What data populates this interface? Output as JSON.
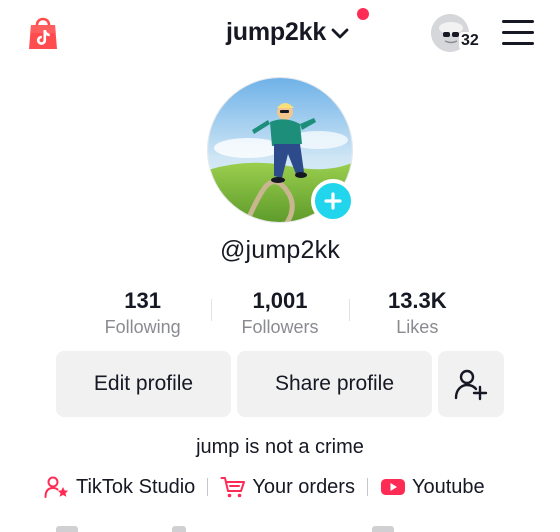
{
  "header": {
    "username": "jump2kk",
    "visitor_count": "32"
  },
  "profile": {
    "handle": "@jump2kk",
    "bio": "jump is not a crime"
  },
  "stats": [
    {
      "value": "131",
      "label": "Following"
    },
    {
      "value": "1,001",
      "label": "Followers"
    },
    {
      "value": "13.3K",
      "label": "Likes"
    }
  ],
  "buttons": {
    "edit": "Edit profile",
    "share": "Share profile"
  },
  "links": [
    {
      "label": "TikTok Studio",
      "icon": "creator-studio-icon"
    },
    {
      "label": "Your orders",
      "icon": "cart-icon"
    },
    {
      "label": "Youtube",
      "icon": "youtube-icon"
    }
  ],
  "colors": {
    "accent_red": "#fe2c55",
    "badge_cyan": "#20d5ec",
    "button_bg": "#f1f1f2",
    "muted_text": "#8a8b91"
  }
}
